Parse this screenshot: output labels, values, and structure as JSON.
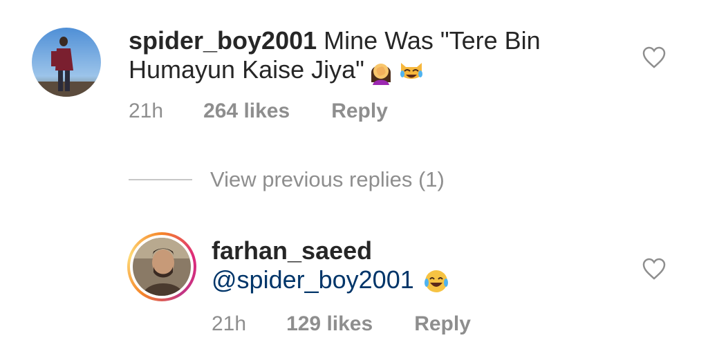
{
  "comments": [
    {
      "username": "spider_boy2001",
      "text_line1": " Mine Was \"Tere Bin",
      "text_line2": "Humayun Kaise Jiya\"",
      "emojis": [
        "woman-facepalming-emoji",
        "cat-tears-of-joy-emoji"
      ],
      "time": "21h",
      "likes": "264 likes",
      "reply_label": "Reply",
      "liked": false
    },
    {
      "username": "farhan_saeed",
      "mention": "@spider_boy2001",
      "emojis": [
        "face-with-tears-of-joy-emoji"
      ],
      "time": "21h",
      "likes": "129 likes",
      "reply_label": "Reply",
      "liked": false,
      "has_story_ring": true
    }
  ],
  "view_previous_replies": "View previous replies (1)",
  "colors": {
    "text": "#262626",
    "meta": "#8e8e8e",
    "mention": "#003569",
    "divider": "#c7c7c7"
  }
}
